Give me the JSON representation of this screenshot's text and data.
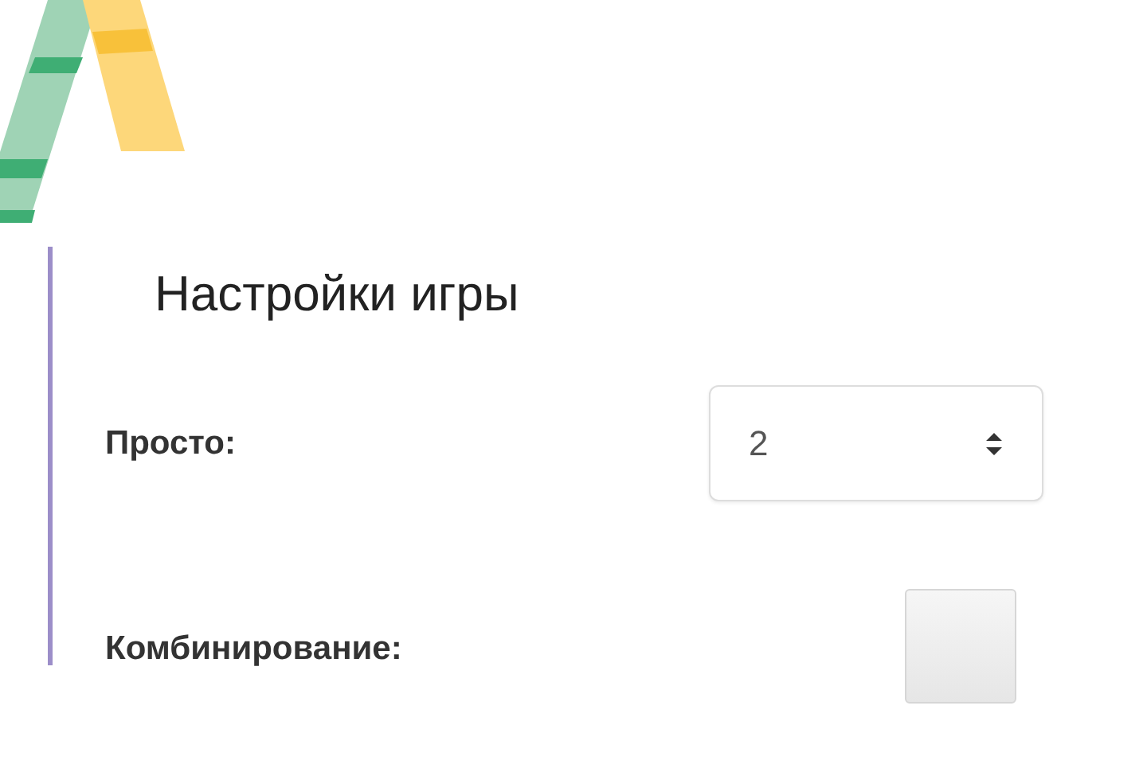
{
  "title": "Настройки игры",
  "settings": [
    {
      "kind": "number",
      "label": "Просто:",
      "value": "2"
    },
    {
      "kind": "checkbox",
      "label": "Комбинирование:",
      "checked": false
    }
  ]
}
